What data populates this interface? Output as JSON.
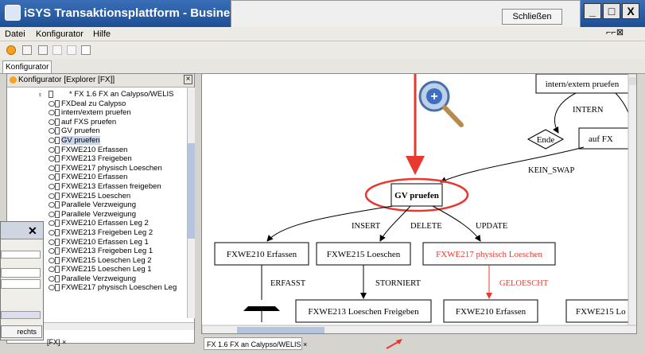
{
  "window": {
    "title": "iSYS Transaktionsplattform - Businessprozess: G"
  },
  "dialog": {
    "close_label": "Schließen"
  },
  "menu": {
    "items": [
      "Datei",
      "Konfigurator",
      "Hilfe"
    ]
  },
  "window_controls": {
    "minimize": "_",
    "maximize": "□",
    "close": "X"
  },
  "tab": {
    "konfigurator": "Konfigurator"
  },
  "explorer": {
    "title": "Konfigurator [Explorer [FX]]",
    "tab_label": "[FX]",
    "root": "* FX 1.6 FX an Calypso/WELIS",
    "items": [
      "FXDeal zu Calypso",
      "intern/extern pruefen",
      "auf FXS pruefen",
      "GV pruefen",
      "GV pruefen",
      "FXWE210 Erfassen",
      "FXWE213 Freigeben",
      "FXWE217 physisch Loeschen",
      "FXWE210 Erfassen",
      "FXWE213 Erfassen freigeben",
      "FXWE215 Loeschen",
      "Parallele Verzweigung",
      "Parallele Verzweigung",
      "FXWE210 Erfassen Leg 2",
      "FXWE213 Freigeben Leg 2",
      "FXWE210 Erfassen Leg 1",
      "FXWE213 Freigeben Leg 1",
      "FXWE215 Loeschen Leg 2",
      "FXWE215 Loeschen Leg 1",
      "Parallele Verzweigung",
      "FXWE217 physisch Loeschen Leg"
    ],
    "selected_index": 4
  },
  "subwindow": {
    "button": "rechts"
  },
  "diagram": {
    "tab_label": "FX 1.6 FX an Calypso/WELIS",
    "nodes": {
      "intern_extern": "intern/extern pruefen",
      "ende": "Ende",
      "auf_fx": "auf FX",
      "gv_pruefen": "GV pruefen",
      "fxwe210_erfassen": "FXWE210 Erfassen",
      "fxwe215_loeschen": "FXWE215 Loeschen",
      "fxwe217_physisch": "FXWE217 physisch Loeschen",
      "fxwe213_loeschen_freigeben": "FXWE213 Loeschen Freigeben",
      "fxwe210_erfassen_2": "FXWE210 Erfassen",
      "fxwe215_lo": "FXWE215 Lo"
    },
    "edges": {
      "intern": "INTERN",
      "kein_swap": "KEIN_SWAP",
      "insert": "INSERT",
      "delete": "DELETE",
      "update": "UPDATE",
      "erfasst": "ERFASST",
      "storniert": "STORNIERT",
      "geloescht": "GELOESCHT"
    },
    "colors": {
      "highlight": "#e8382f",
      "node_border": "#000000"
    }
  }
}
